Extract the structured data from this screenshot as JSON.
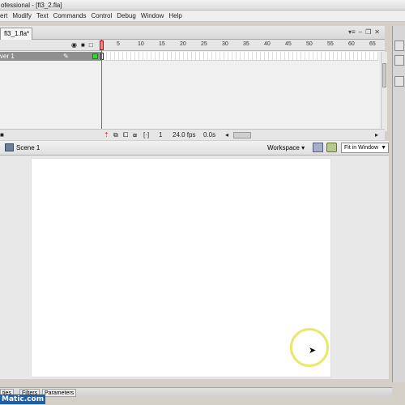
{
  "window": {
    "title": "ofessional - [fl3_2.fla]"
  },
  "menu": [
    "ert",
    "Modify",
    "Text",
    "Commands",
    "Control",
    "Debug",
    "Window",
    "Help"
  ],
  "doc_tab": {
    "label": "fl3_1.fla*"
  },
  "timeline": {
    "ruler_ticks": [
      "5",
      "10",
      "15",
      "20",
      "25",
      "30",
      "35",
      "40",
      "45",
      "50",
      "55",
      "60",
      "65"
    ],
    "layer": {
      "name": "ver 1"
    },
    "status": {
      "frame": "1",
      "fps": "24.0 fps",
      "time": "0.0s"
    }
  },
  "editbar": {
    "scene": "Scene 1",
    "workspace": "Workspace ▾",
    "zoom": "Fit in Window"
  },
  "props": {
    "tabs": [
      "ties",
      "Filters",
      "Parameters"
    ]
  },
  "watermark": "Matic.com",
  "colors": {
    "stage": "#ffffff",
    "layer_color": "#3dd03d",
    "playhead": "#ff3333",
    "highlight": "#e8e86a"
  }
}
